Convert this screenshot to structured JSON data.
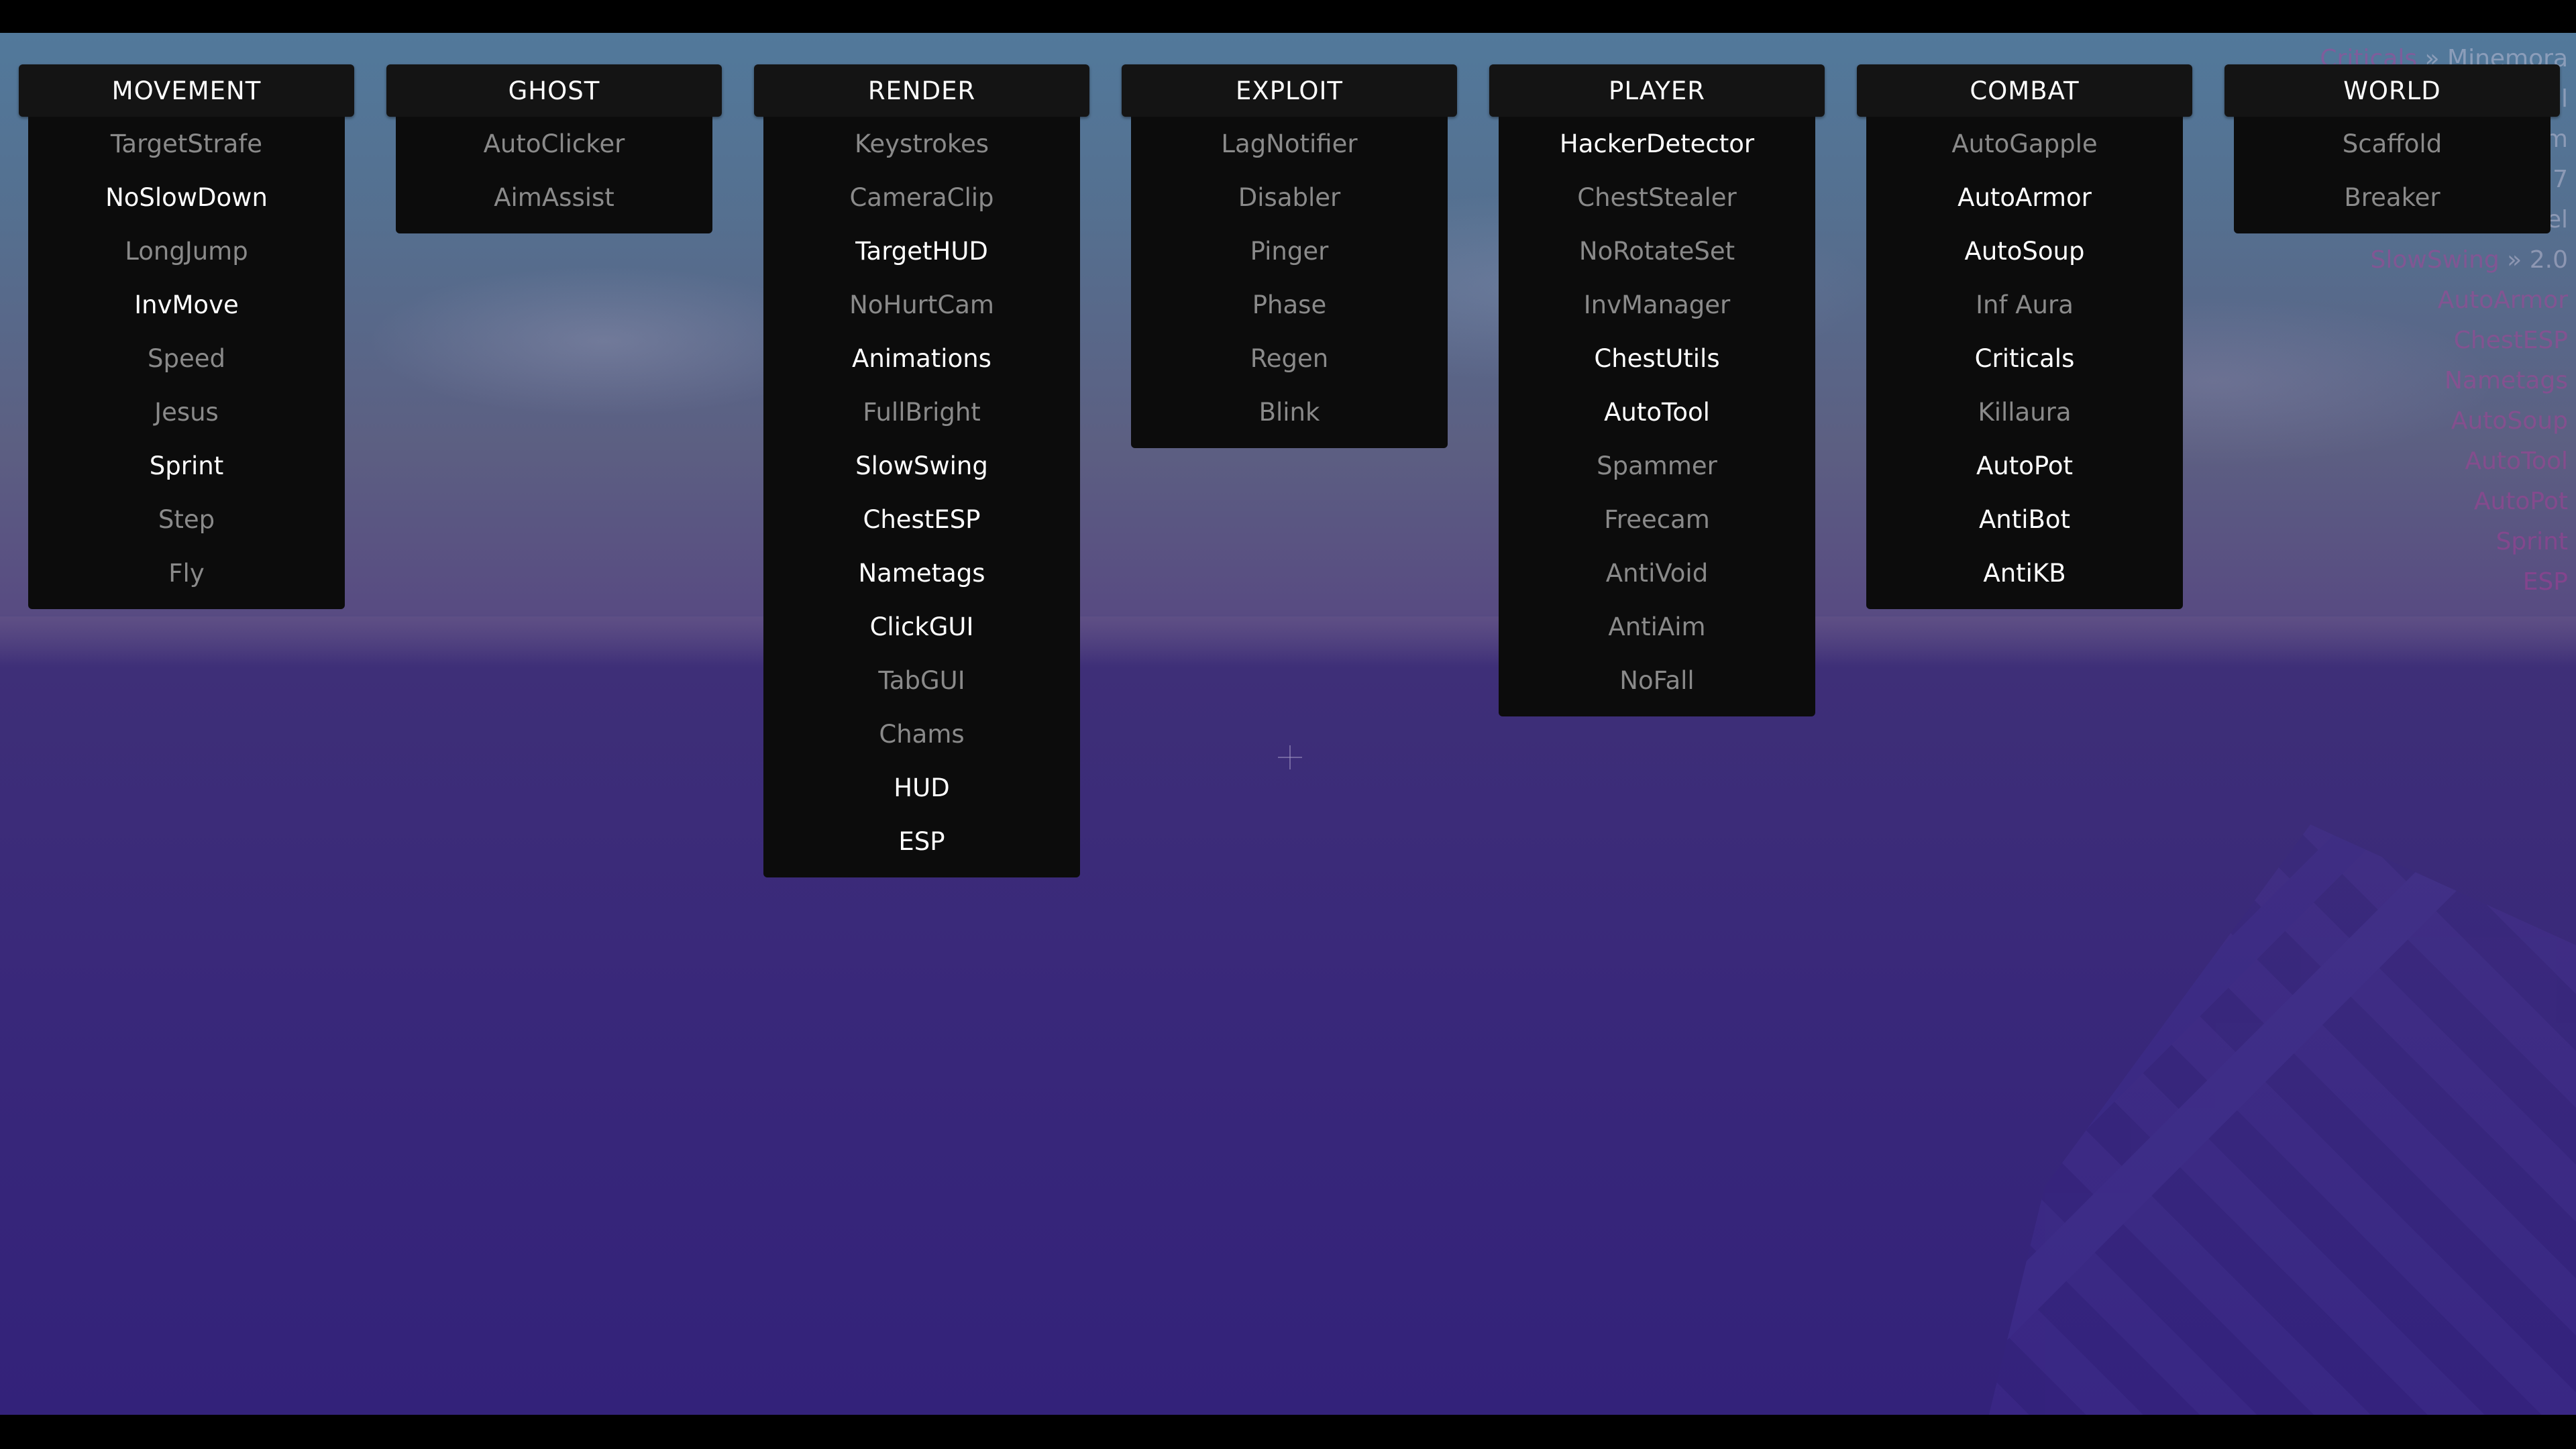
{
  "panels": [
    {
      "title": "MOVEMENT",
      "modules": [
        {
          "label": "TargetStrafe",
          "enabled": false
        },
        {
          "label": "NoSlowDown",
          "enabled": true
        },
        {
          "label": "LongJump",
          "enabled": false
        },
        {
          "label": "InvMove",
          "enabled": true
        },
        {
          "label": "Speed",
          "enabled": false
        },
        {
          "label": "Jesus",
          "enabled": false
        },
        {
          "label": "Sprint",
          "enabled": true
        },
        {
          "label": "Step",
          "enabled": false
        },
        {
          "label": "Fly",
          "enabled": false
        }
      ]
    },
    {
      "title": "GHOST",
      "modules": [
        {
          "label": "AutoClicker",
          "enabled": false
        },
        {
          "label": "AimAssist",
          "enabled": false
        }
      ]
    },
    {
      "title": "RENDER",
      "modules": [
        {
          "label": "Keystrokes",
          "enabled": false
        },
        {
          "label": "CameraClip",
          "enabled": false
        },
        {
          "label": "TargetHUD",
          "enabled": true
        },
        {
          "label": "NoHurtCam",
          "enabled": false
        },
        {
          "label": "Animations",
          "enabled": true
        },
        {
          "label": "FullBright",
          "enabled": false
        },
        {
          "label": "SlowSwing",
          "enabled": true
        },
        {
          "label": "ChestESP",
          "enabled": true
        },
        {
          "label": "Nametags",
          "enabled": true
        },
        {
          "label": "ClickGUI",
          "enabled": true
        },
        {
          "label": "TabGUI",
          "enabled": false
        },
        {
          "label": "Chams",
          "enabled": false
        },
        {
          "label": "HUD",
          "enabled": true
        },
        {
          "label": "ESP",
          "enabled": true
        }
      ]
    },
    {
      "title": "EXPLOIT",
      "modules": [
        {
          "label": "LagNotifier",
          "enabled": false
        },
        {
          "label": "Disabler",
          "enabled": false
        },
        {
          "label": "Pinger",
          "enabled": false
        },
        {
          "label": "Phase",
          "enabled": false
        },
        {
          "label": "Regen",
          "enabled": false
        },
        {
          "label": "Blink",
          "enabled": false
        }
      ]
    },
    {
      "title": "PLAYER",
      "modules": [
        {
          "label": "HackerDetector",
          "enabled": true
        },
        {
          "label": "ChestStealer",
          "enabled": false
        },
        {
          "label": "NoRotateSet",
          "enabled": false
        },
        {
          "label": "InvManager",
          "enabled": false
        },
        {
          "label": "ChestUtils",
          "enabled": true
        },
        {
          "label": "AutoTool",
          "enabled": true
        },
        {
          "label": "Spammer",
          "enabled": false
        },
        {
          "label": "Freecam",
          "enabled": false
        },
        {
          "label": "AntiVoid",
          "enabled": false
        },
        {
          "label": "AntiAim",
          "enabled": false
        },
        {
          "label": "NoFall",
          "enabled": false
        }
      ]
    },
    {
      "title": "COMBAT",
      "modules": [
        {
          "label": "AutoGapple",
          "enabled": false
        },
        {
          "label": "AutoArmor",
          "enabled": true
        },
        {
          "label": "AutoSoup",
          "enabled": true
        },
        {
          "label": "Inf Aura",
          "enabled": false
        },
        {
          "label": "Criticals",
          "enabled": true
        },
        {
          "label": "Killaura",
          "enabled": false
        },
        {
          "label": "AutoPot",
          "enabled": true
        },
        {
          "label": "AntiBot",
          "enabled": true
        },
        {
          "label": "AntiKB",
          "enabled": true
        }
      ]
    },
    {
      "title": "WORLD",
      "modules": [
        {
          "label": "Scaffold",
          "enabled": false
        },
        {
          "label": "Breaker",
          "enabled": false
        }
      ]
    }
  ],
  "arraylist": [
    {
      "name": "Criticals",
      "value": "Minemora"
    },
    {
      "name": "ClickGUI",
      "value": "Normal"
    },
    {
      "name": "AntiBot",
      "value": "Custom"
    },
    {
      "name": "Animations",
      "value": "1.7"
    },
    {
      "name": "AntiKB",
      "value": "Cancel"
    },
    {
      "name": "SlowSwing",
      "value": "2.0"
    },
    {
      "name": "AutoArmor",
      "value": ""
    },
    {
      "name": "ChestESP",
      "value": ""
    },
    {
      "name": "Nametags",
      "value": ""
    },
    {
      "name": "AutoSoup",
      "value": ""
    },
    {
      "name": "AutoTool",
      "value": ""
    },
    {
      "name": "AutoPot",
      "value": ""
    },
    {
      "name": "Sprint",
      "value": ""
    },
    {
      "name": "ESP",
      "value": ""
    }
  ],
  "arraylist_separator": "»",
  "colors": {
    "panel_header": "#141414",
    "panel_body": "#0c0c0c",
    "enabled_text": "#ffffff",
    "disabled_text": "#8a8a8a",
    "arraylist_accent": "#c2369e"
  }
}
